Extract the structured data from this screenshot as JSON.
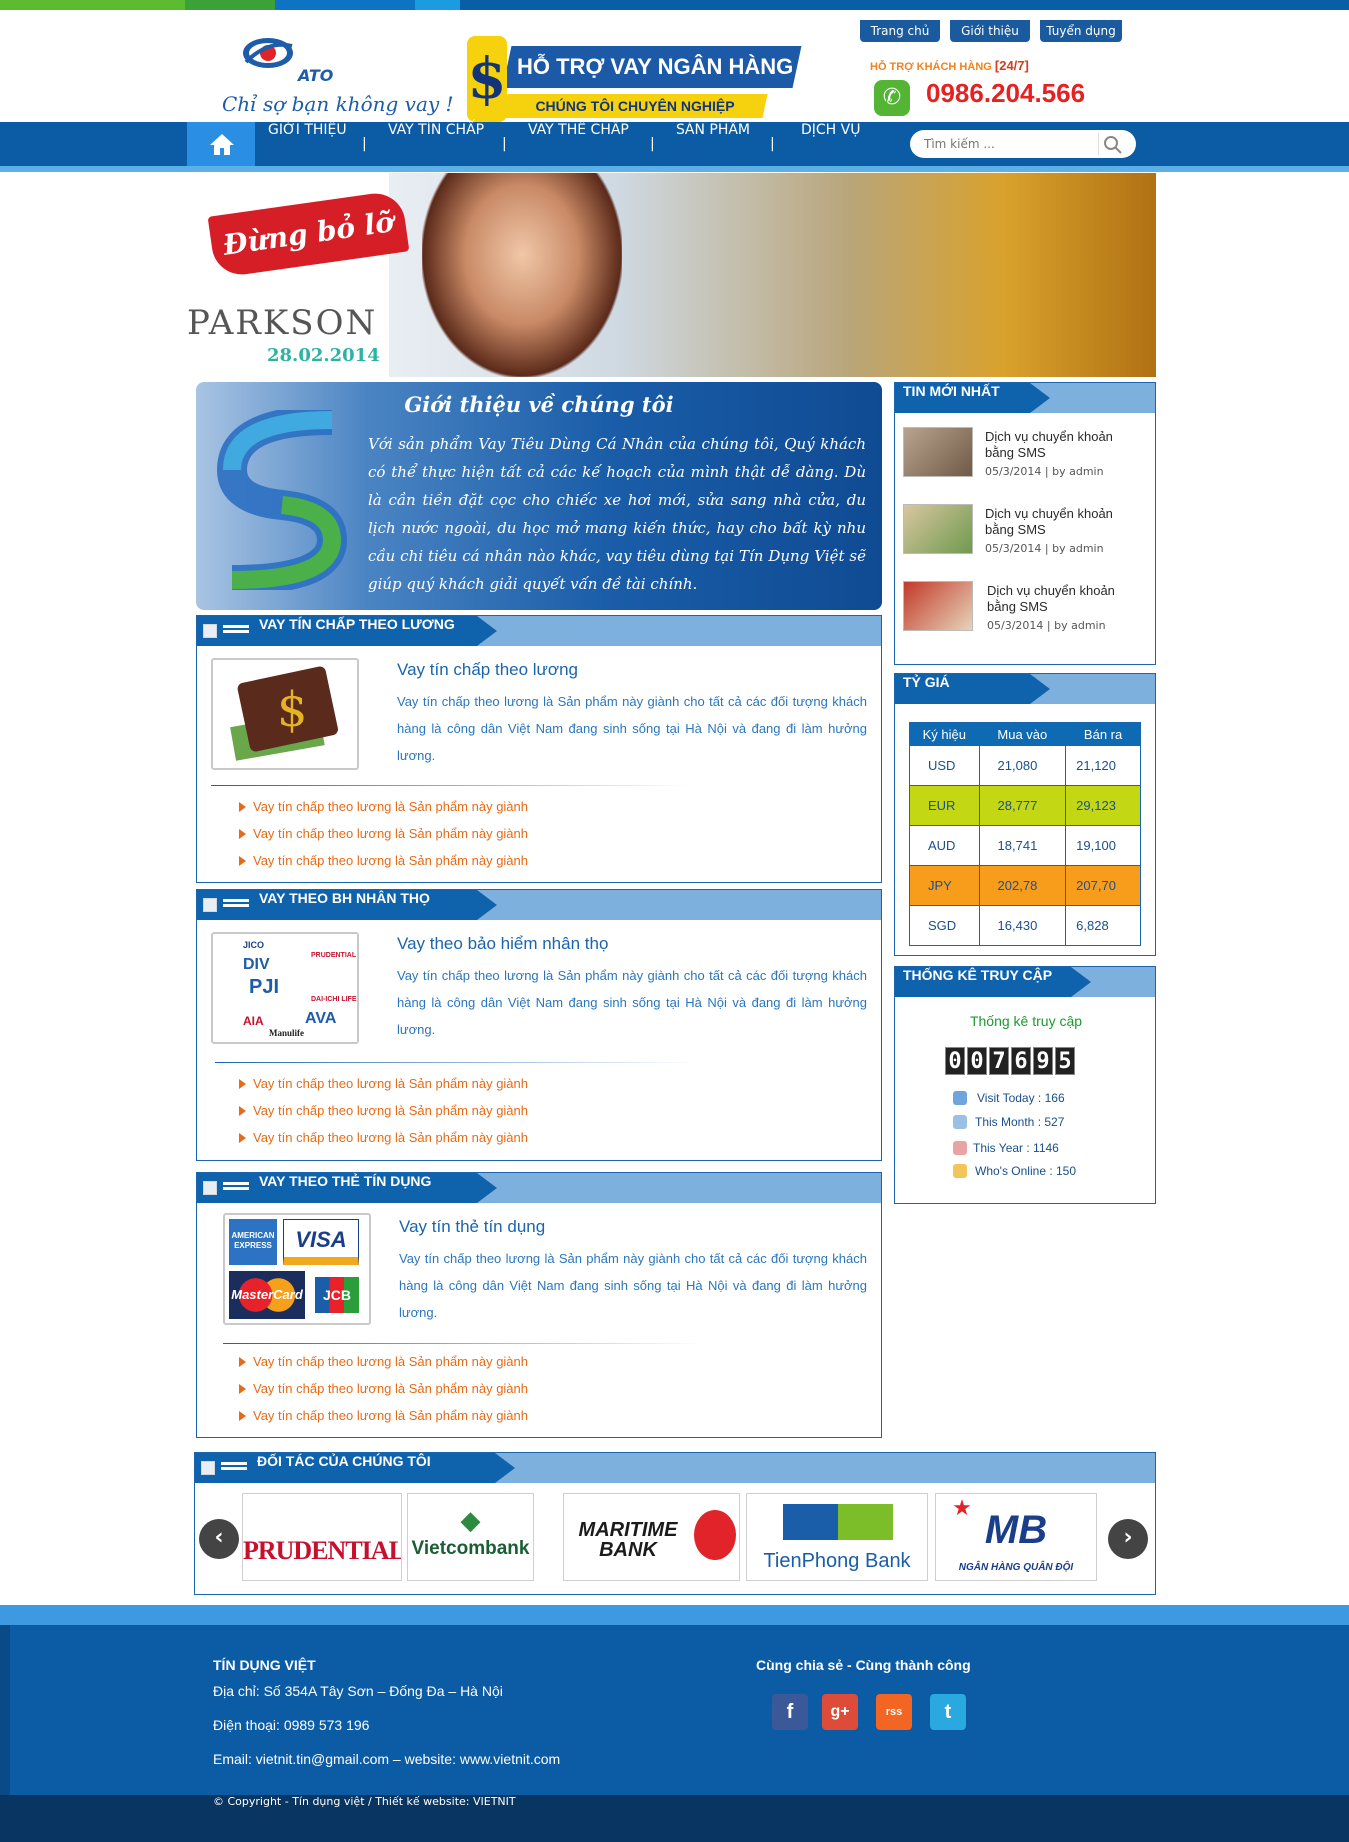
{
  "header": {
    "logo_text": "ATO",
    "slogan": "Chỉ sợ bạn không vay !",
    "ad_title": "HỖ TRỢ VAY NGÂN HÀNG",
    "ad_subtitle": "CHÚNG TÔI CHUYÊN NGHIỆP",
    "toplinks": [
      "Trang chủ",
      "Giới thiệu",
      "Tuyển dụng"
    ],
    "hotline_label": "HỖ TRỢ KHÁCH HÀNG",
    "hotline_hours": "[24/7]",
    "hotline_number": "0986.204.566"
  },
  "nav": {
    "items": [
      "GIỚI THIỆU",
      "VAY TÍN CHẤP",
      "VAY THẾ CHẤP",
      "SẢN PHẨM",
      "DỊCH VỤ"
    ],
    "separator": "|",
    "search_placeholder": "Tìm kiếm ..."
  },
  "hero": {
    "ribbon": "Đừng bỏ lỡ",
    "brand": "PARKSON",
    "date": "28.02.2014"
  },
  "intro": {
    "title": "Giới thiệu về chúng tôi",
    "text": "Với sản phẩm Vay Tiêu Dùng Cá Nhân của chúng tôi, Quý khách có thể thực hiện tất cả các kế hoạch của mình thật dễ dàng. Dù là cần tiền đặt cọc cho chiếc xe hơi mới, sửa sang nhà cửa, du lịch nước ngoài, du học mở mang kiến thức, hay cho bất kỳ nhu cầu chi tiêu cá nhân nào khác, vay tiêu dùng tại Tín Dụng Việt sẽ giúp quý khách giải quyết vấn đề tài chính."
  },
  "sections": [
    {
      "heading": "VAY TÍN CHẤP THEO LƯƠNG",
      "title": "Vay tín chấp theo lương",
      "desc": "Vay tín chấp theo lương là Sản phẩm này giành cho tất cả các đối tượng khách hàng là công dân Việt Nam đang sinh sống tại Hà Nội và đang đi làm hưởng lương.",
      "links": [
        "Vay tín chấp theo lương là Sản phẩm này giành",
        "Vay tín chấp theo lương là Sản phẩm này giành",
        "Vay tín chấp theo lương là Sản phẩm này giành"
      ]
    },
    {
      "heading": "VAY THEO BH NHÂN THỌ",
      "title": "Vay theo bảo hiểm nhân thọ",
      "desc": "Vay tín chấp theo lương là Sản phẩm này giành cho tất cả các đối tượng khách hàng là công dân Việt Nam đang sinh sống tại Hà Nội và đang đi làm hưởng lương.",
      "links": [
        "Vay tín chấp theo lương là Sản phẩm này giành",
        "Vay tín chấp theo lương là Sản phẩm này giành",
        "Vay tín chấp theo lương là Sản phẩm này giành"
      ]
    },
    {
      "heading": "VAY THEO THẺ TÍN DỤNG",
      "title": "Vay tín thẻ tín dụng",
      "desc": "Vay tín chấp theo lương là Sản phẩm này giành cho tất cả các đối tượng khách hàng là công dân Việt Nam đang sinh sống tại Hà Nội và đang đi làm hưởng lương.",
      "links": [
        "Vay tín chấp theo lương là Sản phẩm này giành",
        "Vay tín chấp theo lương là Sản phẩm này giành",
        "Vay tín chấp theo lương là Sản phẩm này giành"
      ]
    }
  ],
  "insurance_logos": [
    "JICO",
    "DIV",
    "PRUDENTIAL",
    "PJI",
    "DAI-ICHI LIFE",
    "AIA",
    "AVA",
    "Manulife"
  ],
  "card_logos": [
    "AMERICAN EXPRESS",
    "VISA",
    "MasterCard",
    "JCB"
  ],
  "partners": {
    "heading": "ĐỐI TÁC CỦA CHÚNG TÔI",
    "names": [
      "PRUDENTIAL",
      "Vietcombank",
      "MARITIME BANK",
      "TienPhong Bank",
      "NGÂN HÀNG QUÂN ĐỘI"
    ],
    "mb_mark": "MB",
    "prev": "‹",
    "next": "›"
  },
  "news": {
    "heading": "TIN MỚI NHẤT",
    "items": [
      {
        "title": "Dịch vụ chuyển khoản bằng SMS",
        "date": "05/3/2014 | by admin"
      },
      {
        "title": "Dịch vụ chuyển khoản bằng SMS",
        "date": "05/3/2014 | by admin"
      },
      {
        "title": "Dịch vụ chuyển khoản bằng SMS",
        "date": "05/3/2014 | by admin"
      }
    ]
  },
  "rates": {
    "heading": "TỶ GIÁ",
    "columns": [
      "Ký hiệu",
      "Mua vào",
      "Bán ra"
    ],
    "rows": [
      [
        "USD",
        "21,080",
        "21,120"
      ],
      [
        "EUR",
        "28,777",
        "29,123"
      ],
      [
        "AUD",
        "18,741",
        "19,100"
      ],
      [
        "JPY",
        "202,78",
        "207,70"
      ],
      [
        "SGD",
        "16,430",
        "6,828"
      ]
    ]
  },
  "stats": {
    "heading": "THỐNG KÊ TRUY CẬP",
    "title": "Thống kê truy cập",
    "counter": [
      "0",
      "0",
      "7",
      "6",
      "9",
      "5"
    ],
    "rows": [
      "Visit Today : 166",
      "This Month : 527",
      "This Year : 1146",
      "Who's Online : 150"
    ]
  },
  "footer": {
    "company": "TÍN DỤNG VIỆT",
    "address": "Địa chỉ: Số 354A Tây Sơn – Đống Đa – Hà Nội",
    "phone": "Điện thoại: 0989 573 196",
    "email": "Email: vietnit.tin@gmail.com – website: www.vietnit.com",
    "share": "Cùng chia sẻ - Cùng thành công",
    "social": [
      "f",
      "g+",
      "rss",
      "t"
    ],
    "copyright": "© Copyright - Tín dụng việt / Thiết kế website: VIETNIT"
  },
  "colors": {
    "primary": "#0b5ba5",
    "accent": "#e66b16",
    "eur_row": "#c3d812",
    "jpy_row": "#f89c1c",
    "hotline": "#e52121"
  }
}
